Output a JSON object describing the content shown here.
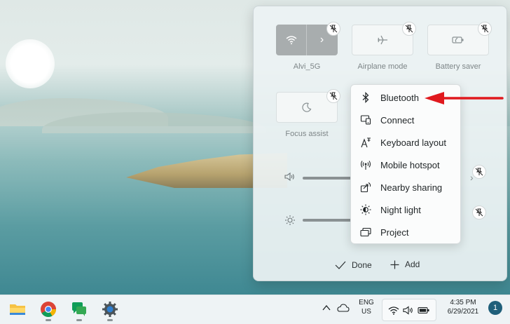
{
  "quick_settings": {
    "tiles": [
      {
        "label": "Alvi_5G",
        "icon": "wifi-icon",
        "state": "on"
      },
      {
        "label": "Airplane mode",
        "icon": "airplane-icon",
        "state": "off"
      },
      {
        "label": "Battery saver",
        "icon": "battery-saver-icon",
        "state": "off"
      },
      {
        "label": "Focus assist",
        "icon": "moon-icon",
        "state": "off"
      }
    ],
    "sliders": [
      {
        "icon": "volume-icon"
      },
      {
        "icon": "brightness-icon"
      }
    ],
    "footer": {
      "done_label": "Done",
      "add_label": "Add"
    }
  },
  "add_menu": {
    "items": [
      {
        "label": "Bluetooth",
        "icon": "bluetooth-icon"
      },
      {
        "label": "Connect",
        "icon": "cast-icon"
      },
      {
        "label": "Keyboard layout",
        "icon": "keyboard-layout-icon"
      },
      {
        "label": "Mobile hotspot",
        "icon": "hotspot-icon"
      },
      {
        "label": "Nearby sharing",
        "icon": "nearby-sharing-icon"
      },
      {
        "label": "Night light",
        "icon": "night-light-icon"
      },
      {
        "label": "Project",
        "icon": "project-icon"
      }
    ],
    "highlighted": "Bluetooth"
  },
  "annotation": {
    "arrow_color": "#e0191e",
    "points_to": "Bluetooth"
  },
  "taskbar": {
    "apps": [
      "file-explorer-icon",
      "chrome-icon",
      "chat-icon",
      "settings-icon"
    ],
    "language_line1": "ENG",
    "language_line2": "US",
    "time": "4:35 PM",
    "date": "6/29/2021",
    "notification_count": "1"
  }
}
